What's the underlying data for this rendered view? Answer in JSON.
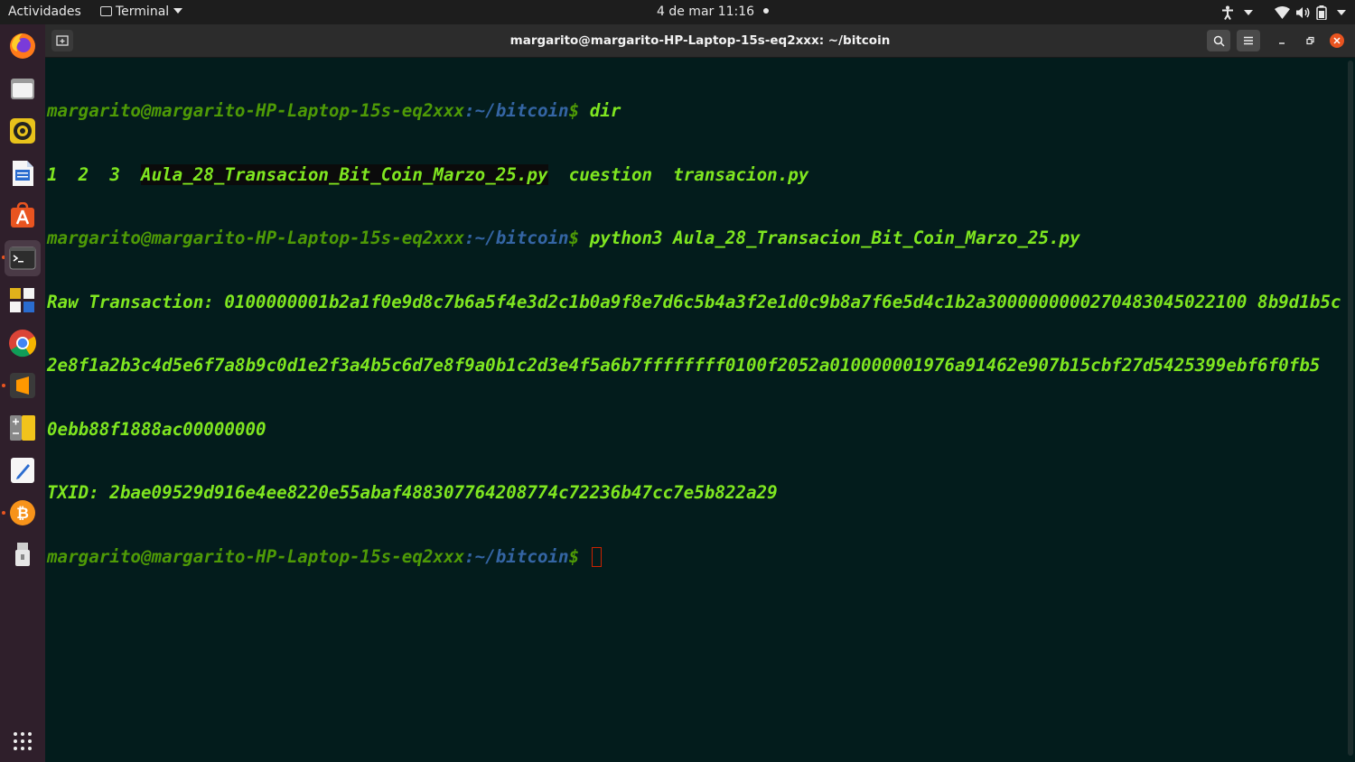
{
  "topbar": {
    "activities": "Actividades",
    "app_menu": "Terminal",
    "clock": "4 de mar  11:16"
  },
  "window": {
    "title": "margarito@margarito-HP-Laptop-15s-eq2xxx: ~/bitcoin"
  },
  "terminal": {
    "prompt_user": "margarito@margarito-HP-Laptop-15s-eq2xxx",
    "prompt_path": ":~/bitcoin",
    "prompt_symbol": "$",
    "cmd1": " dir",
    "dir_items": [
      "1",
      "2",
      "3",
      "Aula_28_Transacion_Bit_Coin_Marzo_25.py",
      "cuestion",
      "transacion.py"
    ],
    "cmd2": " python3 Aula_28_Transacion_Bit_Coin_Marzo_25.py",
    "raw_line1": "Raw Transaction: 0100000001b2a1f0e9d8c7b6a5f4e3d2c1b0a9f8e7d6c5b4a3f2e1d0c9b8a7f6e5d4c1b2a3000000000270483045022100 8b9d1b5c",
    "raw_line2": "2e8f1a2b3c4d5e6f7a8b9c0d1e2f3a4b5c6d7e8f9a0b1c2d3e4f5a6b7ffffffff0100f2052a010000001976a91462e907b15cbf27d5425399ebf6f0fb5",
    "raw_line3": "0ebb88f1888ac00000000",
    "txid_line": "TXID: 2bae09529d916e4ee8220e55abaf488307764208774c72236b47cc7e5b822a29"
  },
  "dock": {
    "items": [
      "firefox-icon",
      "files-icon",
      "rhythmbox-icon",
      "writer-icon",
      "software-icon",
      "terminal-icon",
      "apps-grid-icon-small",
      "chrome-icon",
      "sublime-icon",
      "calculator-icon",
      "text-editor-icon",
      "bitcoin-icon",
      "usb-icon"
    ]
  }
}
